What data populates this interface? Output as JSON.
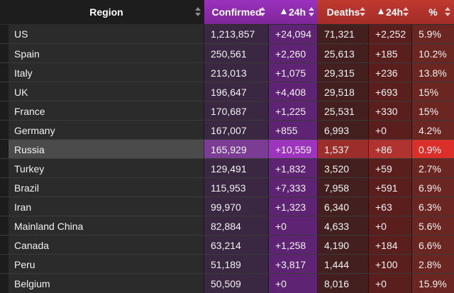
{
  "headers": {
    "region": "Region",
    "confirmed": "Confirmed",
    "confirmed_24h": "24h",
    "deaths": "Deaths",
    "deaths_24h": "24h",
    "percent": "%"
  },
  "colors": {
    "header_confirmed": "#8a2aa8",
    "header_deaths": "#b3302c",
    "highlight_percent": "#dc2f2a"
  },
  "highlighted_region": "Russia",
  "rows": [
    {
      "region": "US",
      "confirmed": "1,213,857",
      "confirmed_24h": "+24,094",
      "deaths": "71,321",
      "deaths_24h": "+2,252",
      "percent": "5.9%"
    },
    {
      "region": "Spain",
      "confirmed": "250,561",
      "confirmed_24h": "+2,260",
      "deaths": "25,613",
      "deaths_24h": "+185",
      "percent": "10.2%"
    },
    {
      "region": "Italy",
      "confirmed": "213,013",
      "confirmed_24h": "+1,075",
      "deaths": "29,315",
      "deaths_24h": "+236",
      "percent": "13.8%"
    },
    {
      "region": "UK",
      "confirmed": "196,647",
      "confirmed_24h": "+4,408",
      "deaths": "29,518",
      "deaths_24h": "+693",
      "percent": "15%"
    },
    {
      "region": "France",
      "confirmed": "170,687",
      "confirmed_24h": "+1,225",
      "deaths": "25,531",
      "deaths_24h": "+330",
      "percent": "15%"
    },
    {
      "region": "Germany",
      "confirmed": "167,007",
      "confirmed_24h": "+855",
      "deaths": "6,993",
      "deaths_24h": "+0",
      "percent": "4.2%"
    },
    {
      "region": "Russia",
      "confirmed": "165,929",
      "confirmed_24h": "+10,559",
      "deaths": "1,537",
      "deaths_24h": "+86",
      "percent": "0.9%"
    },
    {
      "region": "Turkey",
      "confirmed": "129,491",
      "confirmed_24h": "+1,832",
      "deaths": "3,520",
      "deaths_24h": "+59",
      "percent": "2.7%"
    },
    {
      "region": "Brazil",
      "confirmed": "115,953",
      "confirmed_24h": "+7,333",
      "deaths": "7,958",
      "deaths_24h": "+591",
      "percent": "6.9%"
    },
    {
      "region": "Iran",
      "confirmed": "99,970",
      "confirmed_24h": "+1,323",
      "deaths": "6,340",
      "deaths_24h": "+63",
      "percent": "6.3%"
    },
    {
      "region": "Mainland China",
      "confirmed": "82,884",
      "confirmed_24h": "+0",
      "deaths": "4,633",
      "deaths_24h": "+0",
      "percent": "5.6%"
    },
    {
      "region": "Canada",
      "confirmed": "63,214",
      "confirmed_24h": "+1,258",
      "deaths": "4,190",
      "deaths_24h": "+184",
      "percent": "6.6%"
    },
    {
      "region": "Peru",
      "confirmed": "51,189",
      "confirmed_24h": "+3,817",
      "deaths": "1,444",
      "deaths_24h": "+100",
      "percent": "2.8%"
    },
    {
      "region": "Belgium",
      "confirmed": "50,509",
      "confirmed_24h": "+0",
      "deaths": "8,016",
      "deaths_24h": "+0",
      "percent": "15.9%"
    }
  ]
}
